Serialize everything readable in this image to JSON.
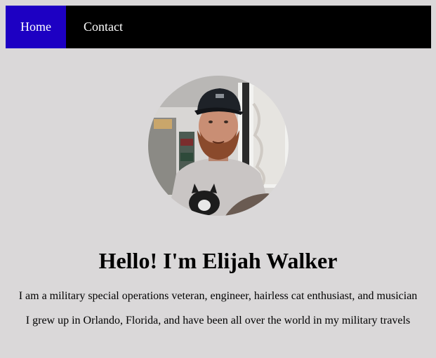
{
  "nav": {
    "items": [
      {
        "label": "Home",
        "active": true
      },
      {
        "label": "Contact",
        "active": false
      }
    ],
    "active_color": "#1d00c3",
    "background_color": "#000000"
  },
  "profile": {
    "photo": "profile-photo"
  },
  "hero": {
    "heading": "Hello! I'm Elijah Walker",
    "line1": "I am a military special operations veteran, engineer, hairless cat enthusiast, and musician",
    "line2": "I grew up in Orlando, Florida, and have been all over the world in my military travels"
  },
  "colors": {
    "page_background": "#dad8d9"
  }
}
